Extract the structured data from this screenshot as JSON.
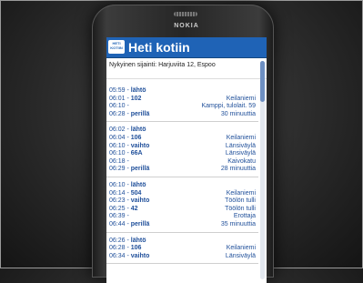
{
  "device": {
    "brand": "NOKIA"
  },
  "app": {
    "logo_line1": "HETI",
    "logo_line2": "KOTIIN",
    "title": "Heti kotiin",
    "location": "Nykyinen sijainti: Harjuviita 12, Espoo"
  },
  "routes": [
    {
      "rows": [
        {
          "time": "05:59",
          "action": "lähtö",
          "dest": ""
        },
        {
          "time": "06:01",
          "action": "102",
          "dest": "Keilaniemi"
        },
        {
          "time": "06:10",
          "action": "",
          "dest": "Kamppi, tulolait. 59"
        },
        {
          "time": "06:28",
          "action": "perillä",
          "dest": "30 minuuttia"
        }
      ]
    },
    {
      "rows": [
        {
          "time": "06:02",
          "action": "lähtö",
          "dest": ""
        },
        {
          "time": "06:04",
          "action": "106",
          "dest": "Keilaniemi"
        },
        {
          "time": "06:10",
          "action": "vaihto",
          "dest": "Länsiväylä"
        },
        {
          "time": "06:10",
          "action": "66A",
          "dest": "Länsiväylä"
        },
        {
          "time": "06:18",
          "action": "",
          "dest": "Kaivokatu"
        },
        {
          "time": "06:29",
          "action": "perillä",
          "dest": "28 minuuttia"
        }
      ]
    },
    {
      "rows": [
        {
          "time": "06:10",
          "action": "lähtö",
          "dest": ""
        },
        {
          "time": "06:14",
          "action": "504",
          "dest": "Keilaniemi"
        },
        {
          "time": "06:23",
          "action": "vaihto",
          "dest": "Töölön tulli"
        },
        {
          "time": "06:25",
          "action": "42",
          "dest": "Töölön tulli"
        },
        {
          "time": "06:39",
          "action": "",
          "dest": "Erottaja"
        },
        {
          "time": "06:44",
          "action": "perillä",
          "dest": "35 minuuttia"
        }
      ]
    },
    {
      "rows": [
        {
          "time": "06:26",
          "action": "lähtö",
          "dest": ""
        },
        {
          "time": "06:28",
          "action": "106",
          "dest": "Keilaniemi"
        },
        {
          "time": "06:34",
          "action": "vaihto",
          "dest": "Länsiväylä"
        }
      ]
    }
  ]
}
